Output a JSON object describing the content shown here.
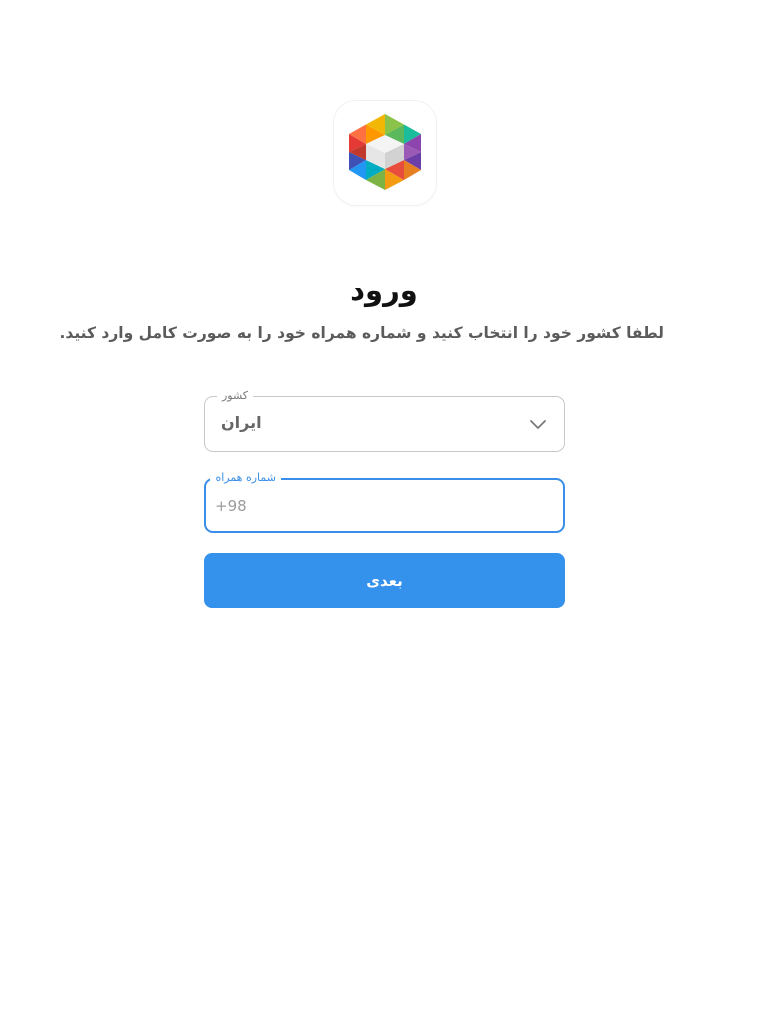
{
  "login": {
    "logo_icon": "rubika-hexagon-logo-icon",
    "title": "ورود",
    "subtitle": "لطفا کشور خود را انتخاب کنید و شماره همراه خود را به صورت کامل وارد کنید.",
    "country_field": {
      "label": "کشور",
      "value": "ایران",
      "icon": "chevron-down-icon"
    },
    "phone_field": {
      "label": "شماره همراه",
      "placeholder": "+98",
      "value": ""
    },
    "next_button": "بعدی"
  },
  "colors": {
    "primary": "#3592ec",
    "focus_border": "#3a8ee8",
    "title": "#111111",
    "subtitle": "#5b5b5b"
  }
}
